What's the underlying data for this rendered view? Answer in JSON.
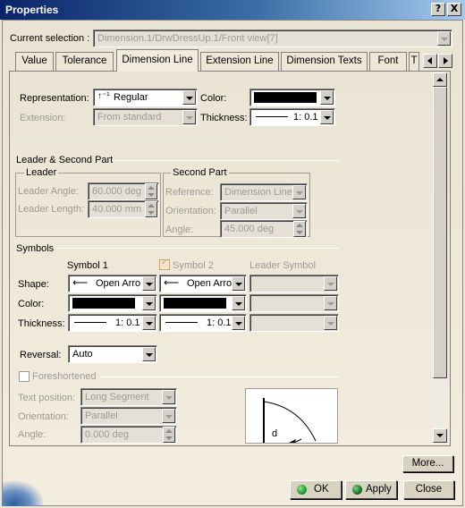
{
  "window": {
    "title": "Properties",
    "help_label": "?",
    "close_label": "X"
  },
  "selection": {
    "label": "Current selection :",
    "value": "Dimension.1/DrwDressUp.1/Front view[7]"
  },
  "tabs": [
    {
      "label": "Value"
    },
    {
      "label": "Tolerance"
    },
    {
      "label": "Dimension Line"
    },
    {
      "label": "Extension Line"
    },
    {
      "label": "Dimension Texts"
    },
    {
      "label": "Font"
    },
    {
      "label": "T"
    }
  ],
  "top": {
    "representation_label": "Representation:",
    "representation_value": "Regular",
    "color_label": "Color:",
    "extension_label": "Extension:",
    "extension_value": "From standard",
    "thickness_label": "Thickness:",
    "thickness_value": "1: 0.1"
  },
  "leader_second": {
    "title": "Leader & Second Part",
    "leader": {
      "title": "Leader",
      "angle_label": "Leader Angle:",
      "angle_value": "60.000 deg",
      "length_label": "Leader Length:",
      "length_value": "40.000 mm"
    },
    "second": {
      "title": "Second Part",
      "reference_label": "Reference:",
      "reference_value": "Dimension Line",
      "orientation_label": "Orientation:",
      "orientation_value": "Parallel",
      "angle_label": "Angle:",
      "angle_value": "45.000 deg"
    }
  },
  "symbols": {
    "title": "Symbols",
    "col1": "Symbol 1",
    "col2": "Symbol 2",
    "col3": "Leader Symbol",
    "shape_label": "Shape:",
    "shape1": "Open Arro",
    "shape2": "Open Arro",
    "color_label": "Color:",
    "thickness_label": "Thickness:",
    "thick1": "1: 0.1",
    "thick2": "1: 0.1"
  },
  "reversal": {
    "label": "Reversal:",
    "value": "Auto"
  },
  "foreshortened": {
    "label": "Foreshortened",
    "text_position_label": "Text position:",
    "text_position_value": "Long Segment",
    "orientation_label": "Orientation:",
    "orientation_value": "Parallel",
    "angle_label": "Angle:",
    "angle_value": "0.000 deg",
    "preview_letter": "d"
  },
  "buttons": {
    "more": "More...",
    "ok": "OK",
    "apply": "Apply",
    "close": "Close"
  },
  "colors": {
    "titlebar": "#0A246A",
    "bg": "#ECE6D6",
    "ok_icon": "#1E9A2A",
    "apply_icon": "#1E7A2A"
  }
}
